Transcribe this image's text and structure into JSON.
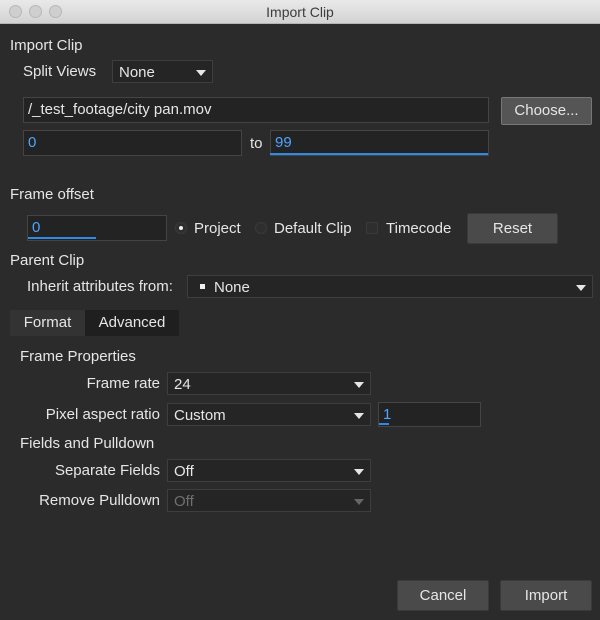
{
  "window": {
    "title": "Import Clip"
  },
  "import_clip": {
    "heading": "Import Clip",
    "split_views_label": "Split Views",
    "split_views_value": "None",
    "file_path": "/_test_footage/city pan.mov",
    "choose_label": "Choose...",
    "range_start": "0",
    "range_to_label": "to",
    "range_end": "99"
  },
  "frame_offset": {
    "heading": "Frame offset",
    "value": "0",
    "options": [
      "Project",
      "Default Clip",
      "Timecode"
    ],
    "reset_label": "Reset"
  },
  "parent_clip": {
    "heading": "Parent Clip",
    "inherit_label": "Inherit attributes from:",
    "inherit_value": "None"
  },
  "tabs": [
    {
      "label": "Format"
    },
    {
      "label": "Advanced"
    }
  ],
  "frame_properties": {
    "heading": "Frame Properties",
    "frame_rate_label": "Frame rate",
    "frame_rate_value": "24",
    "pixel_aspect_label": "Pixel aspect ratio",
    "pixel_aspect_value": "Custom",
    "pixel_aspect_custom": "1"
  },
  "fields_pulldown": {
    "heading": "Fields and Pulldown",
    "separate_fields_label": "Separate Fields",
    "separate_fields_value": "Off",
    "remove_pulldown_label": "Remove Pulldown",
    "remove_pulldown_value": "Off"
  },
  "footer": {
    "cancel_label": "Cancel",
    "import_label": "Import"
  }
}
